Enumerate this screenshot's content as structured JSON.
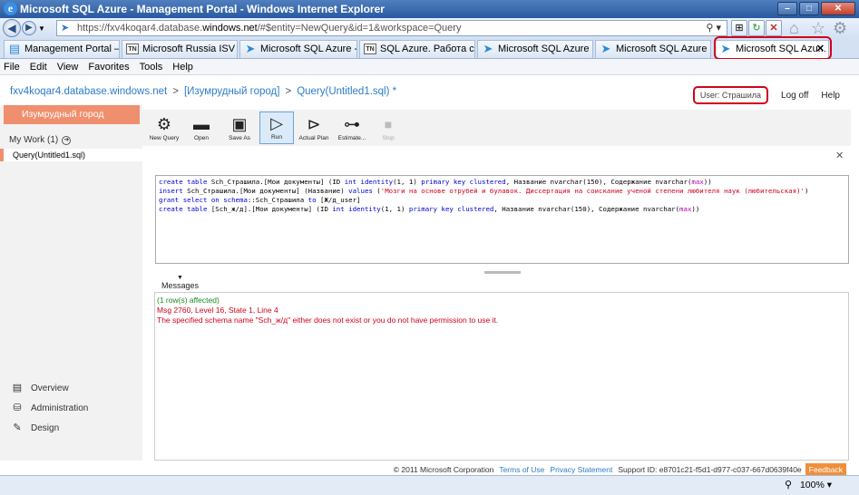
{
  "window": {
    "title": "Microsoft SQL Azure - Management Portal - Windows Internet Explorer",
    "min_label": "–",
    "max_label": "□",
    "close_label": "✕"
  },
  "address": {
    "url_prefix": "https://fxv4koqar4.database.",
    "url_domain": "windows.net",
    "url_suffix": "/#$entity=NewQuery&id=1&workspace=Query"
  },
  "tabs": [
    {
      "label": "Management Portal – ...",
      "icon": "ie-page-icon"
    },
    {
      "label": "Microsoft Russia ISV T...",
      "icon": "tn-icon"
    },
    {
      "label": "Microsoft SQL Azure - ...",
      "icon": "azure-icon"
    },
    {
      "label": "SQL Azure. Работа с ...",
      "icon": "tn-icon"
    },
    {
      "label": "Microsoft SQL Azure - ...",
      "icon": "azure-icon"
    },
    {
      "label": "Microsoft SQL Azure - ...",
      "icon": "azure-icon"
    },
    {
      "label": "Microsoft SQL Azu...",
      "icon": "azure-icon"
    }
  ],
  "menu": [
    "File",
    "Edit",
    "View",
    "Favorites",
    "Tools",
    "Help"
  ],
  "breadcrumb": {
    "server": "fxv4koqar4.database.windows.net",
    "database": "[Изумрудный город]",
    "query": "Query(Untitled1.sql) *"
  },
  "header": {
    "user": "User: Страшила",
    "logoff": "Log off",
    "help": "Help"
  },
  "sidebar": {
    "db_tab": "Изумрудный город",
    "my_work": "My Work (1)",
    "query_item": "Query(Untitled1.sql)",
    "nav": [
      {
        "label": "Overview",
        "icon": "overview-icon"
      },
      {
        "label": "Administration",
        "icon": "administration-icon"
      },
      {
        "label": "Design",
        "icon": "design-icon"
      }
    ]
  },
  "toolbar": {
    "new_query": "New Query",
    "open": "Open",
    "save_as": "Save As",
    "run": "Run",
    "actual_plan": "Actual Plan",
    "estimate": "Estimate...",
    "stop": "Stop"
  },
  "editor": {
    "l1_a": "create table",
    "l1_b": " Sch_Страшила.[Мои документы] (ID ",
    "l1_c": "int identity",
    "l1_d": "(1, 1) ",
    "l1_e": "primary key clustered",
    "l1_f": ", Название nvarchar(150), Содержание nvarchar(",
    "l1_g": "max",
    "l1_h": "))",
    "l2_a": "insert",
    "l2_b": " Sch_Страшила.[Мои документы] (Название) ",
    "l2_c": "values",
    "l2_d": " (",
    "l2_e": "'Мозги на основе отрубей и булавок. Диссертация на соискание ученой степени любителя наук (любительская)'",
    "l2_f": ")",
    "l3_a": "grant select on schema",
    "l3_b": "::Sch_Страшила ",
    "l3_c": "to",
    "l3_d": " [Ж/д_user]",
    "l4_a": "create table",
    "l4_b": " [Sch_ж/д].[Мои документы] (ID ",
    "l4_c": "int identity",
    "l4_d": "(1, 1) ",
    "l4_e": "primary key clustered",
    "l4_f": ", Название nvarchar(150), Содержание nvarchar(",
    "l4_g": "max",
    "l4_h": "))"
  },
  "messages": {
    "tab_label": "Messages",
    "line1": "(1 row(s) affected)",
    "line2": "Msg 2760, Level 16, State 1, Line 4",
    "line3": "The specified schema name \"Sch_ж/д\" either does not exist or you do not have permission to use it."
  },
  "footer": {
    "copyright": "© 2011 Microsoft Corporation",
    "terms": "Terms of Use",
    "privacy": "Privacy Statement",
    "support": "Support ID: e8701c21-f5d1-d977-c037-667d0639f40e",
    "feedback": "Feedback"
  },
  "statusbar": {
    "zoom": "100%"
  },
  "colors": {
    "accent_orange": "#f08f6e",
    "link_blue": "#2d7cc8",
    "error_red": "#d0001b",
    "success_green": "#1a8a1a"
  }
}
